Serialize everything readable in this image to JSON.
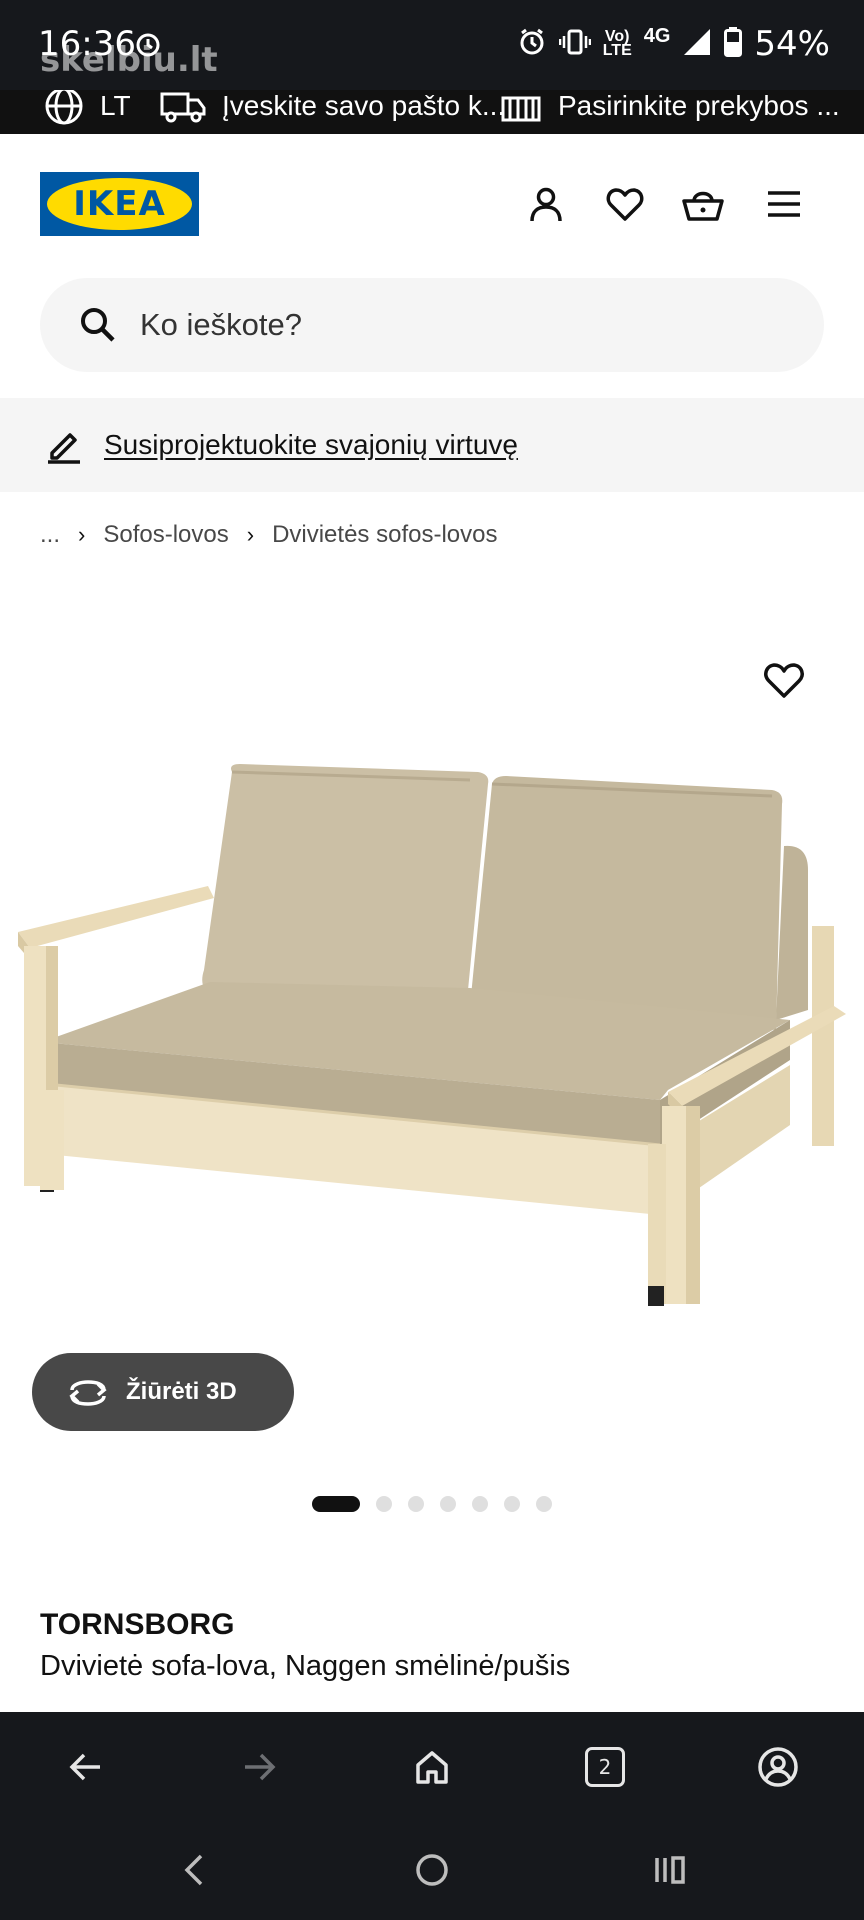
{
  "status_bar": {
    "time": "16:36",
    "watermark": "skelbiu.lt",
    "network_volte": "Vo\nLTE",
    "network_type": "4G",
    "battery": "54%"
  },
  "top_strip": {
    "language": "LT",
    "postcode_prompt": "Įveskite savo pašto k...",
    "store_prompt": "Pasirinkite prekybos ..."
  },
  "header": {
    "logo_text": "IKEA"
  },
  "search": {
    "placeholder": "Ko ieškote?"
  },
  "promo": {
    "link_text": "Susiprojektuokite svajonių virtuvę"
  },
  "breadcrumb": {
    "ellipsis": "...",
    "items": [
      "Sofos-lovos",
      "Dvivietės sofos-lovos"
    ]
  },
  "gallery": {
    "view_3d_label": "Žiūrėti 3D",
    "image_count": 7,
    "active_index": 0
  },
  "product": {
    "name": "TORNSBORG",
    "description": "Dvivietė sofa-lova, Naggen smėlinė/pušis"
  },
  "browser_bar": {
    "tab_count": "2"
  },
  "colors": {
    "ikea_blue": "#0058a3",
    "ikea_yellow": "#ffdb00",
    "dark_bar": "#16181c"
  }
}
